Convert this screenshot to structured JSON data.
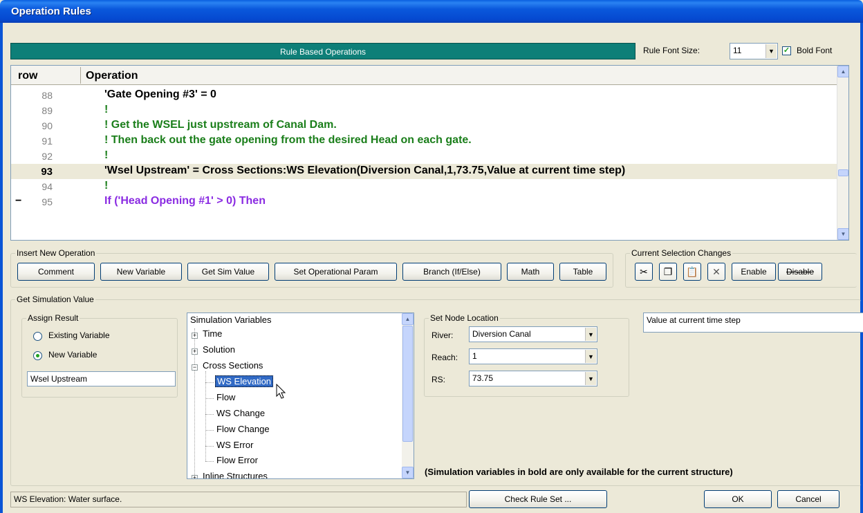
{
  "window": {
    "title": "Operation Rules"
  },
  "header": {
    "bar_label": "Rule Based Operations",
    "font_size_label": "Rule Font Size:",
    "font_size_value": "11",
    "bold_font_label": "Bold Font",
    "bold_font_checked": true
  },
  "grid": {
    "col_row": "row",
    "col_operation": "Operation",
    "rows": [
      {
        "num": "88",
        "text": "'Gate Opening #3' = 0",
        "color": "#000000"
      },
      {
        "num": "89",
        "text": "!",
        "color": "#1A7E1A"
      },
      {
        "num": "90",
        "text": "! Get the WSEL just upstream of Canal Dam.",
        "color": "#1A7E1A"
      },
      {
        "num": "91",
        "text": "! Then back out the gate opening from the desired Head on each gate.",
        "color": "#1A7E1A"
      },
      {
        "num": "92",
        "text": "!",
        "color": "#1A7E1A"
      },
      {
        "num": "93",
        "text": "'Wsel Upstream' = Cross Sections:WS Elevation(Diversion Canal,1,73.75,Value at current time step)",
        "color": "#000000",
        "selected": true
      },
      {
        "num": "94",
        "text": "!",
        "color": "#1A7E1A"
      },
      {
        "num": "95",
        "text": "If ('Head Opening #1' > 0) Then",
        "color": "#8A2BE2",
        "collapse": "−"
      }
    ]
  },
  "insert": {
    "legend": "Insert New Operation",
    "buttons": [
      "Comment",
      "New Variable",
      "Get Sim Value",
      "Set Operational Param",
      "Branch (If/Else)",
      "Math",
      "Table"
    ]
  },
  "selection": {
    "legend": "Current Selection Changes",
    "enable": "Enable",
    "disable": "Disable"
  },
  "getsim": {
    "legend": "Get Simulation Value",
    "assign": {
      "legend": "Assign Result",
      "existing": "Existing Variable",
      "new": "New Variable",
      "selected": "new",
      "var_name": "Wsel Upstream"
    },
    "tree": {
      "root": "Simulation Variables",
      "items": [
        "Time",
        "Solution",
        "Cross Sections"
      ],
      "children": [
        "WS Elevation",
        "Flow",
        "WS Change",
        "Flow Change",
        "WS Error",
        "Flow Error"
      ],
      "last": "Inline Structures"
    },
    "node": {
      "legend": "Set Node Location",
      "river_label": "River:",
      "river_value": "Diversion Canal",
      "reach_label": "Reach:",
      "reach_value": "1",
      "rs_label": "RS:",
      "rs_value": "73.75"
    },
    "value_type": "Value at current time step",
    "note": "(Simulation variables in bold are only available for the current structure)"
  },
  "footer": {
    "status": "WS Elevation: Water surface.",
    "check": "Check Rule Set ...",
    "ok": "OK",
    "cancel": "Cancel"
  }
}
